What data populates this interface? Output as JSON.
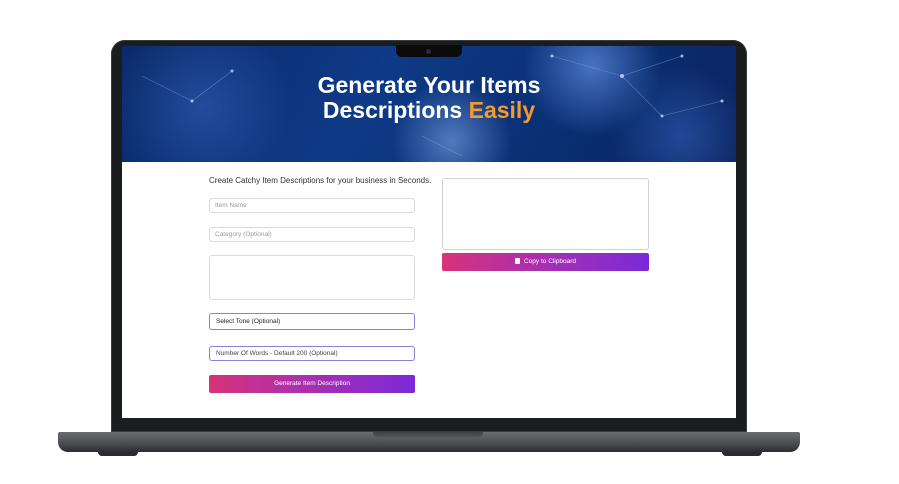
{
  "hero": {
    "title_line1": "Generate Your Items",
    "title_line2_prefix": "Descriptions",
    "title_line2_accent": "Easily"
  },
  "form": {
    "intro": "Create Catchy Item Descriptions for your business in Seconds.",
    "item_name_placeholder": "Item Name",
    "category_placeholder": "Category (Optional)",
    "tone_selected": "Select Tone (Optional)",
    "words_placeholder": "Number Of Words - Default 200 (Optional)",
    "generate_label": "Generate Item Description"
  },
  "output": {
    "copy_label": "Copy to Clipboard",
    "copy_icon": "clipboard-icon"
  },
  "colors": {
    "accent": "#f59a2b",
    "button_gradient_start": "#d8327a",
    "button_gradient_end": "#7b2ad8",
    "hero_background": "#0e3a86"
  }
}
